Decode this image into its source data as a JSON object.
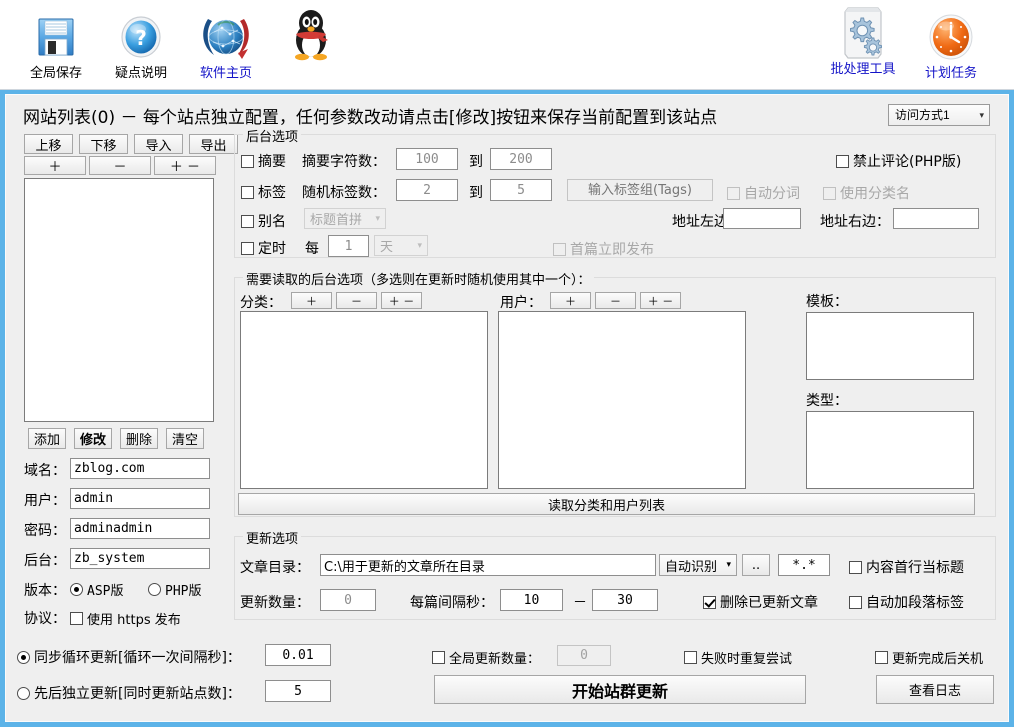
{
  "toolbar": {
    "items": [
      {
        "label": "全局保存",
        "icon": "floppy-disk-icon",
        "link": false
      },
      {
        "label": "疑点说明",
        "icon": "question-mark-icon",
        "link": false
      },
      {
        "label": "软件主页",
        "icon": "globe-icon",
        "link": true
      },
      {
        "label": "",
        "icon": "qq-penguin-icon",
        "link": false
      },
      {
        "label": "批处理工具",
        "icon": "gears-tool-icon",
        "link": true
      },
      {
        "label": "计划任务",
        "icon": "clock-icon",
        "link": true
      }
    ]
  },
  "header": {
    "title": "网站列表(0)  －  每个站点独立配置，任何参数改动请点击[修改]按钮来保存当前配置到该站点",
    "access_mode": "访问方式1"
  },
  "sitelist": {
    "buttons_row1": [
      "上移",
      "下移",
      "导入",
      "导出"
    ],
    "buttons_row2": [
      "＋",
      "－",
      "＋ －"
    ],
    "buttons_row3": [
      "添加",
      "修改",
      "删除",
      "清空"
    ],
    "fields": [
      {
        "label": "域名：",
        "value": "zblog.com"
      },
      {
        "label": "用户：",
        "value": "admin"
      },
      {
        "label": "密码：",
        "value": "adminadmin"
      },
      {
        "label": "后台：",
        "value": "zb_system"
      }
    ],
    "version_label": "版本：",
    "version_options": [
      "ASP版",
      "PHP版"
    ],
    "version_selected": "ASP版",
    "protocol_label": "协议：",
    "protocol_checkbox": "使用 https 发布",
    "protocol_checked": false
  },
  "backend_options": {
    "title": "后台选项",
    "summary": {
      "label": "摘要",
      "checked": false,
      "chars_label": "摘要字符数：",
      "min": "100",
      "to": "到",
      "max": "200"
    },
    "tags": {
      "label": "标签",
      "checked": false,
      "count_label": "随机标签数：",
      "min": "2",
      "to": "到",
      "max": "5",
      "input_placeholder": "输入标签组(Tags)",
      "auto_segment": "自动分词",
      "auto_segment_checked": false,
      "use_category_name": "使用分类名",
      "use_category_name_checked": false
    },
    "alias": {
      "label": "别名",
      "checked": false,
      "combo_value": "标题首拼"
    },
    "timer": {
      "label": "定时",
      "checked": false,
      "every": "每",
      "value": "1",
      "unit": "天",
      "first_publish": "首篇立即发布",
      "first_publish_checked": false
    },
    "disable_comment": {
      "label": "禁止评论(PHP版)",
      "checked": false
    },
    "addr_left_label": "地址左边：",
    "addr_left_value": "",
    "addr_right_label": "地址右边：",
    "addr_right_value": ""
  },
  "read_options": {
    "title": "需要读取的后台选项（多选则在更新时随机使用其中一个）：",
    "category_label": "分类：",
    "category_buttons": [
      "＋",
      "－",
      "＋ －"
    ],
    "user_label": "用户：",
    "user_buttons": [
      "＋",
      "－",
      "＋ －"
    ],
    "template_label": "模板：",
    "type_label": "类型：",
    "read_button": "读取分类和用户列表"
  },
  "update_options": {
    "title": "更新选项",
    "dir_label": "文章目录：",
    "dir_value": "C:\\用于更新的文章所在目录",
    "encoding_combo": "自动识别",
    "browse_button": "..",
    "filter_value": "*.*",
    "first_line_title": {
      "label": "内容首行当标题",
      "checked": false
    },
    "count_label": "更新数量：",
    "count_value": "0",
    "interval_label": "每篇间隔秒：",
    "interval_min": "10",
    "interval_dash": "－",
    "interval_max": "30",
    "delete_updated": {
      "label": "删除已更新文章",
      "checked": true
    },
    "auto_paragraph": {
      "label": "自动加段落标签",
      "checked": false
    }
  },
  "footer": {
    "mode1": {
      "label": "同步循环更新[循环一次间隔秒]：",
      "value": "0.01",
      "selected": true
    },
    "mode2": {
      "label": "先后独立更新[同时更新站点数]：",
      "value": "5",
      "selected": false
    },
    "global_count": {
      "label": "全局更新数量：",
      "checked": false,
      "value": "0"
    },
    "retry_on_fail": {
      "label": "失败时重复尝试",
      "checked": false
    },
    "shutdown_after": {
      "label": "更新完成后关机",
      "checked": false
    },
    "start_button": "开始站群更新",
    "log_button": "查看日志"
  },
  "colors": {
    "panel_border": "#5cb3e8",
    "link": "#1414c8",
    "bg": "#efefef"
  }
}
